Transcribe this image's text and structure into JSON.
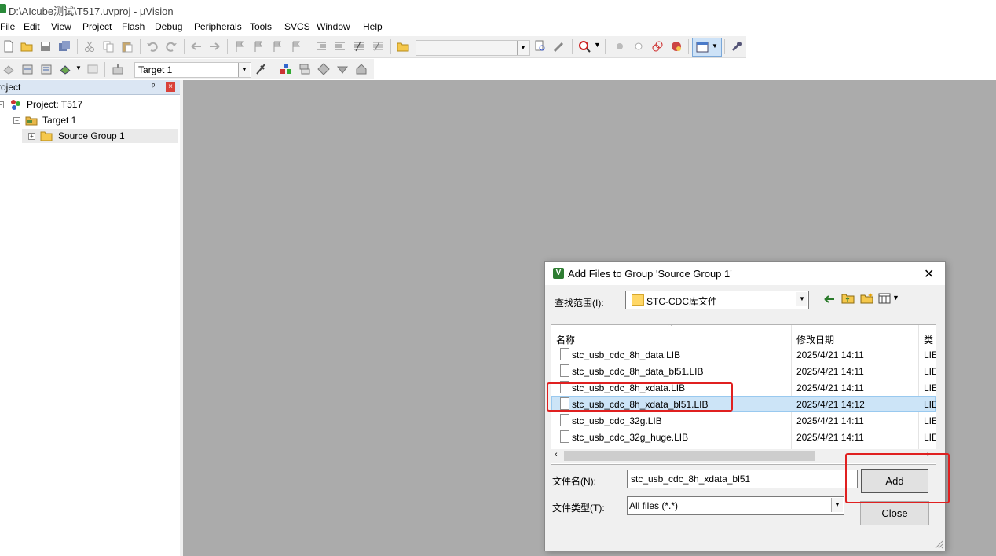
{
  "window": {
    "title": "D:\\AIcube测试\\T517.uvproj - µVision"
  },
  "menu": [
    "File",
    "Edit",
    "View",
    "Project",
    "Flash",
    "Debug",
    "Peripherals",
    "Tools",
    "SVCS",
    "Window",
    "Help"
  ],
  "toolbar2": {
    "target_select": "Target 1"
  },
  "project_panel": {
    "header": "roject",
    "pin_glyph": "ᵖ",
    "close_glyph": "×",
    "tree": [
      {
        "label": "Project: T517"
      },
      {
        "label": "Target 1"
      },
      {
        "label": "Source Group 1"
      }
    ]
  },
  "dialog": {
    "title": "Add Files to Group 'Source Group 1'",
    "close_glyph": "✕",
    "look_in_label": "查找范围(I):",
    "look_in_value": "STC-CDC库文件",
    "columns": {
      "name": "名称",
      "modified": "修改日期",
      "type": "类"
    },
    "files": [
      {
        "name": "stc_usb_cdc_8h_data.LIB",
        "modified": "2025/4/21 14:11",
        "type": "LIE"
      },
      {
        "name": "stc_usb_cdc_8h_data_bl51.LIB",
        "modified": "2025/4/21 14:11",
        "type": "LIE"
      },
      {
        "name": "stc_usb_cdc_8h_xdata.LIB",
        "modified": "2025/4/21 14:11",
        "type": "LIE"
      },
      {
        "name": "stc_usb_cdc_8h_xdata_bl51.LIB",
        "modified": "2025/4/21 14:12",
        "type": "LIE",
        "selected": true
      },
      {
        "name": "stc_usb_cdc_32g.LIB",
        "modified": "2025/4/21 14:11",
        "type": "LIE"
      },
      {
        "name": "stc_usb_cdc_32g_huge.LIB",
        "modified": "2025/4/21 14:11",
        "type": "LIE"
      }
    ],
    "filename_label": "文件名(N):",
    "filename_value": "stc_usb_cdc_8h_xdata_bl51",
    "filetype_label": "文件类型(T):",
    "filetype_value": "All files (*.*)",
    "add_button": "Add",
    "close_button": "Close"
  },
  "colors": {
    "highlight": "#e02020",
    "selection": "#cce4f7",
    "workspace": "#ababab"
  }
}
